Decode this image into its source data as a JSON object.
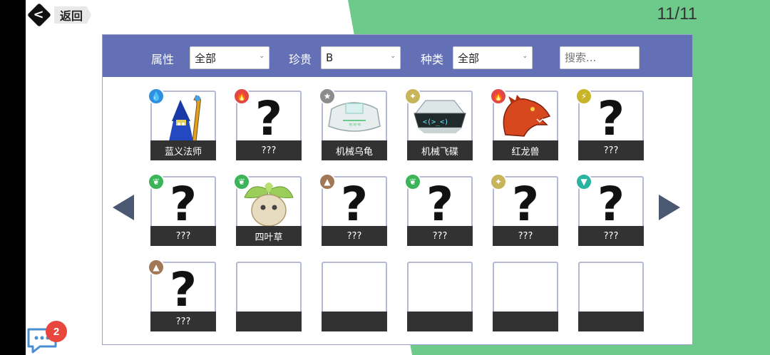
{
  "header": {
    "back_label": "返回",
    "page_indicator": "11/11"
  },
  "filters": {
    "attribute_label": "属性",
    "attribute_value": "全部",
    "rarity_label": "珍贵",
    "rarity_value": "B",
    "kind_label": "种类",
    "kind_value": "全部",
    "search_placeholder": "搜索..."
  },
  "colors": {
    "water": "#2f8fe0",
    "fire": "#e04848",
    "normal": "#8c8c8c",
    "light": "#c8b45a",
    "electric": "#c8b428",
    "grass": "#3cb45a",
    "ground": "#a07858",
    "wind": "#28b4a0",
    "header_bg": "#6370b5",
    "bg_green": "#6dca8a"
  },
  "cards": [
    {
      "name": "蓝义法师",
      "element": "water",
      "icon": "water-drop-icon",
      "glyph": "💧",
      "pic": "blue-mage"
    },
    {
      "name": "???",
      "element": "fire",
      "icon": "fire-icon",
      "glyph": "🔥",
      "pic": "unknown"
    },
    {
      "name": "机械乌龟",
      "element": "normal",
      "icon": "star-icon",
      "glyph": "★",
      "pic": "mech-turtle"
    },
    {
      "name": "机械飞碟",
      "element": "light",
      "icon": "sparkle-icon",
      "glyph": "✦",
      "pic": "mech-ufo"
    },
    {
      "name": "红龙兽",
      "element": "fire",
      "icon": "fire-icon",
      "glyph": "🔥",
      "pic": "red-dragon"
    },
    {
      "name": "???",
      "element": "electric",
      "icon": "lightning-icon",
      "glyph": "⚡",
      "pic": "unknown"
    },
    {
      "name": "???",
      "element": "grass",
      "icon": "leaf-icon",
      "glyph": "❦",
      "pic": "unknown"
    },
    {
      "name": "四叶草",
      "element": "grass",
      "icon": "leaf-icon",
      "glyph": "❦",
      "pic": "clover"
    },
    {
      "name": "???",
      "element": "ground",
      "icon": "mountain-icon",
      "glyph": "▲",
      "pic": "unknown"
    },
    {
      "name": "???",
      "element": "grass",
      "icon": "leaf-icon",
      "glyph": "❦",
      "pic": "unknown"
    },
    {
      "name": "???",
      "element": "light",
      "icon": "sparkle-icon",
      "glyph": "✦",
      "pic": "unknown"
    },
    {
      "name": "???",
      "element": "wind",
      "icon": "tornado-icon",
      "glyph": "▼",
      "pic": "unknown"
    },
    {
      "name": "???",
      "element": "ground",
      "icon": "mountain-icon",
      "glyph": "▲",
      "pic": "unknown"
    },
    {
      "name": "",
      "element": "",
      "icon": "",
      "glyph": "",
      "pic": "empty"
    },
    {
      "name": "",
      "element": "",
      "icon": "",
      "glyph": "",
      "pic": "empty"
    },
    {
      "name": "",
      "element": "",
      "icon": "",
      "glyph": "",
      "pic": "empty"
    },
    {
      "name": "",
      "element": "",
      "icon": "",
      "glyph": "",
      "pic": "empty"
    },
    {
      "name": "",
      "element": "",
      "icon": "",
      "glyph": "",
      "pic": "empty"
    }
  ],
  "chat": {
    "unread_count": "2"
  }
}
